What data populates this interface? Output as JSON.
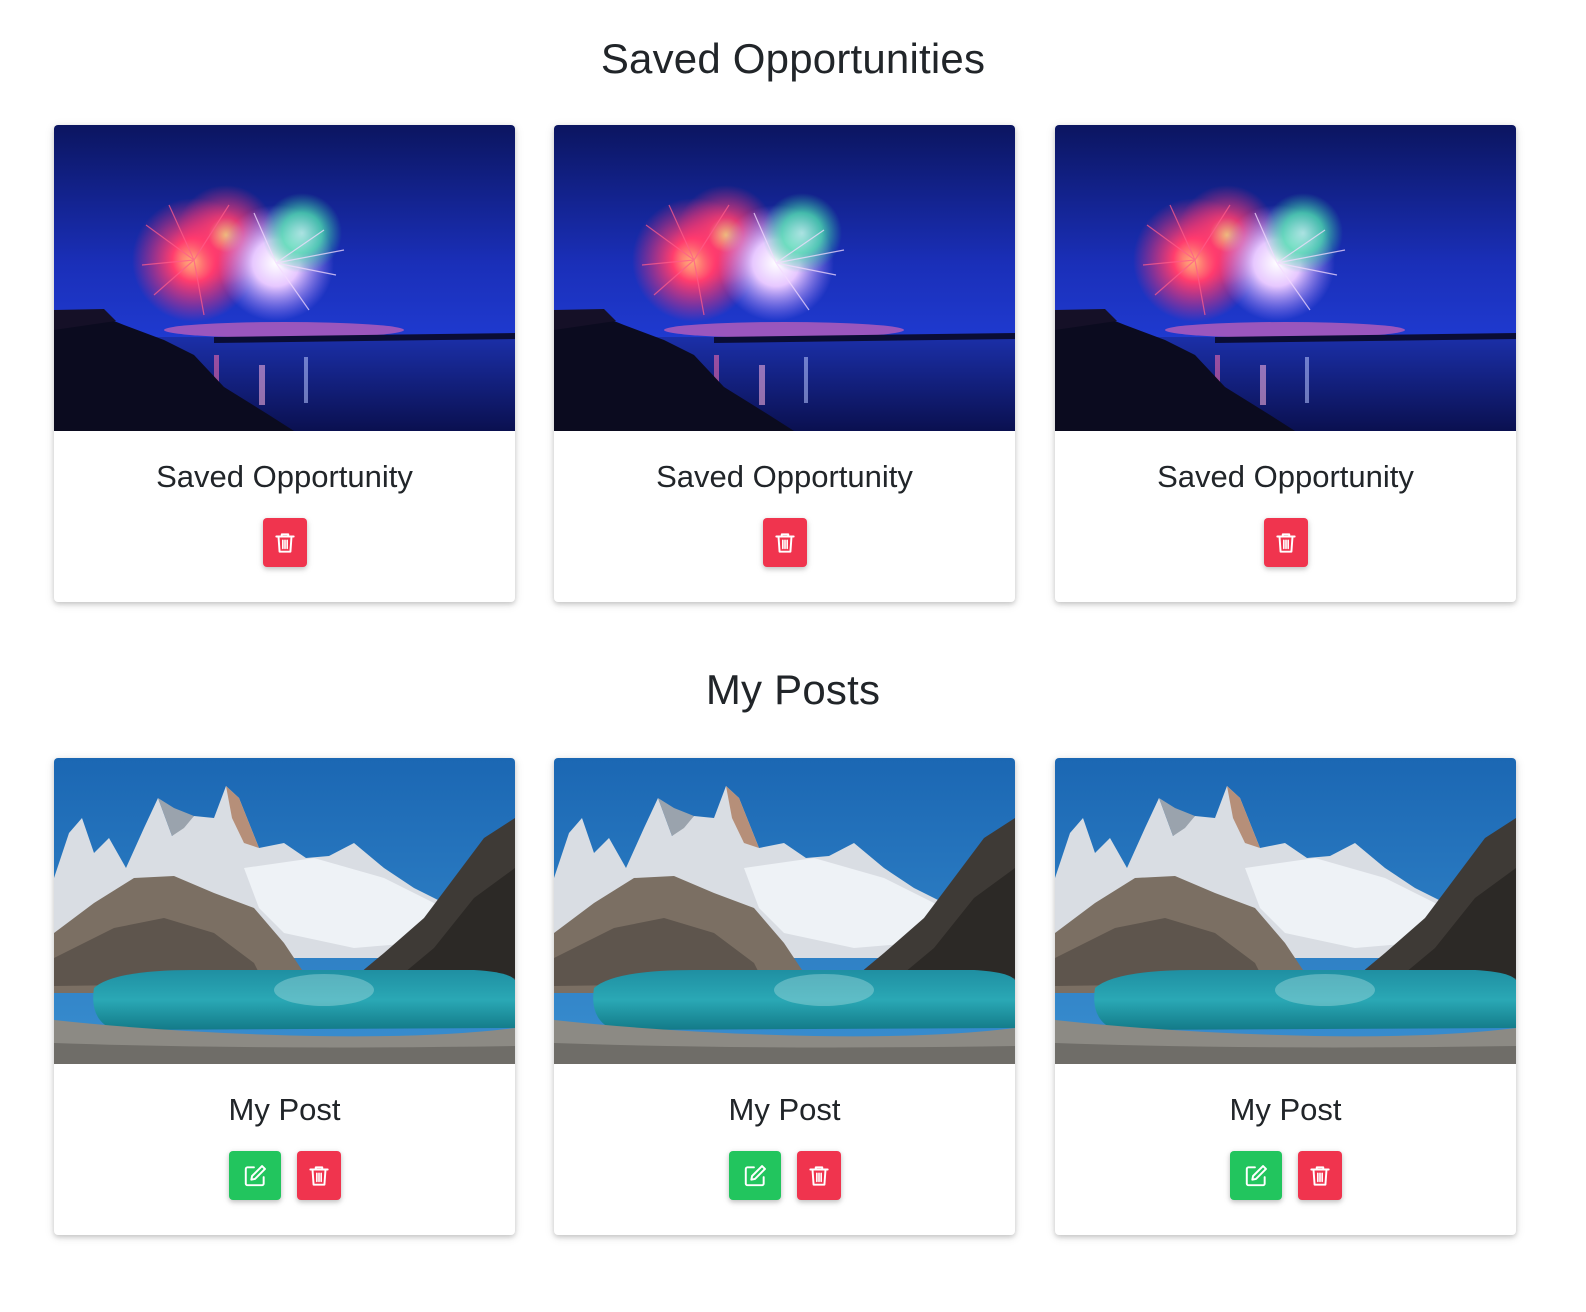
{
  "saved": {
    "title": "Saved Opportunities",
    "cards": [
      {
        "title": "Saved Opportunity",
        "image": "fireworks-over-lake",
        "delete_icon": "trash-icon"
      },
      {
        "title": "Saved Opportunity",
        "image": "fireworks-over-lake",
        "delete_icon": "trash-icon"
      },
      {
        "title": "Saved Opportunity",
        "image": "fireworks-over-lake",
        "delete_icon": "trash-icon"
      }
    ]
  },
  "posts": {
    "title": "My Posts",
    "cards": [
      {
        "title": "My Post",
        "image": "mountain-lake",
        "edit_icon": "edit-icon",
        "delete_icon": "trash-icon"
      },
      {
        "title": "My Post",
        "image": "mountain-lake",
        "edit_icon": "edit-icon",
        "delete_icon": "trash-icon"
      },
      {
        "title": "My Post",
        "image": "mountain-lake",
        "edit_icon": "edit-icon",
        "delete_icon": "trash-icon"
      }
    ]
  },
  "colors": {
    "delete": "#f0344e",
    "edit": "#22c55e",
    "text": "#212529"
  }
}
